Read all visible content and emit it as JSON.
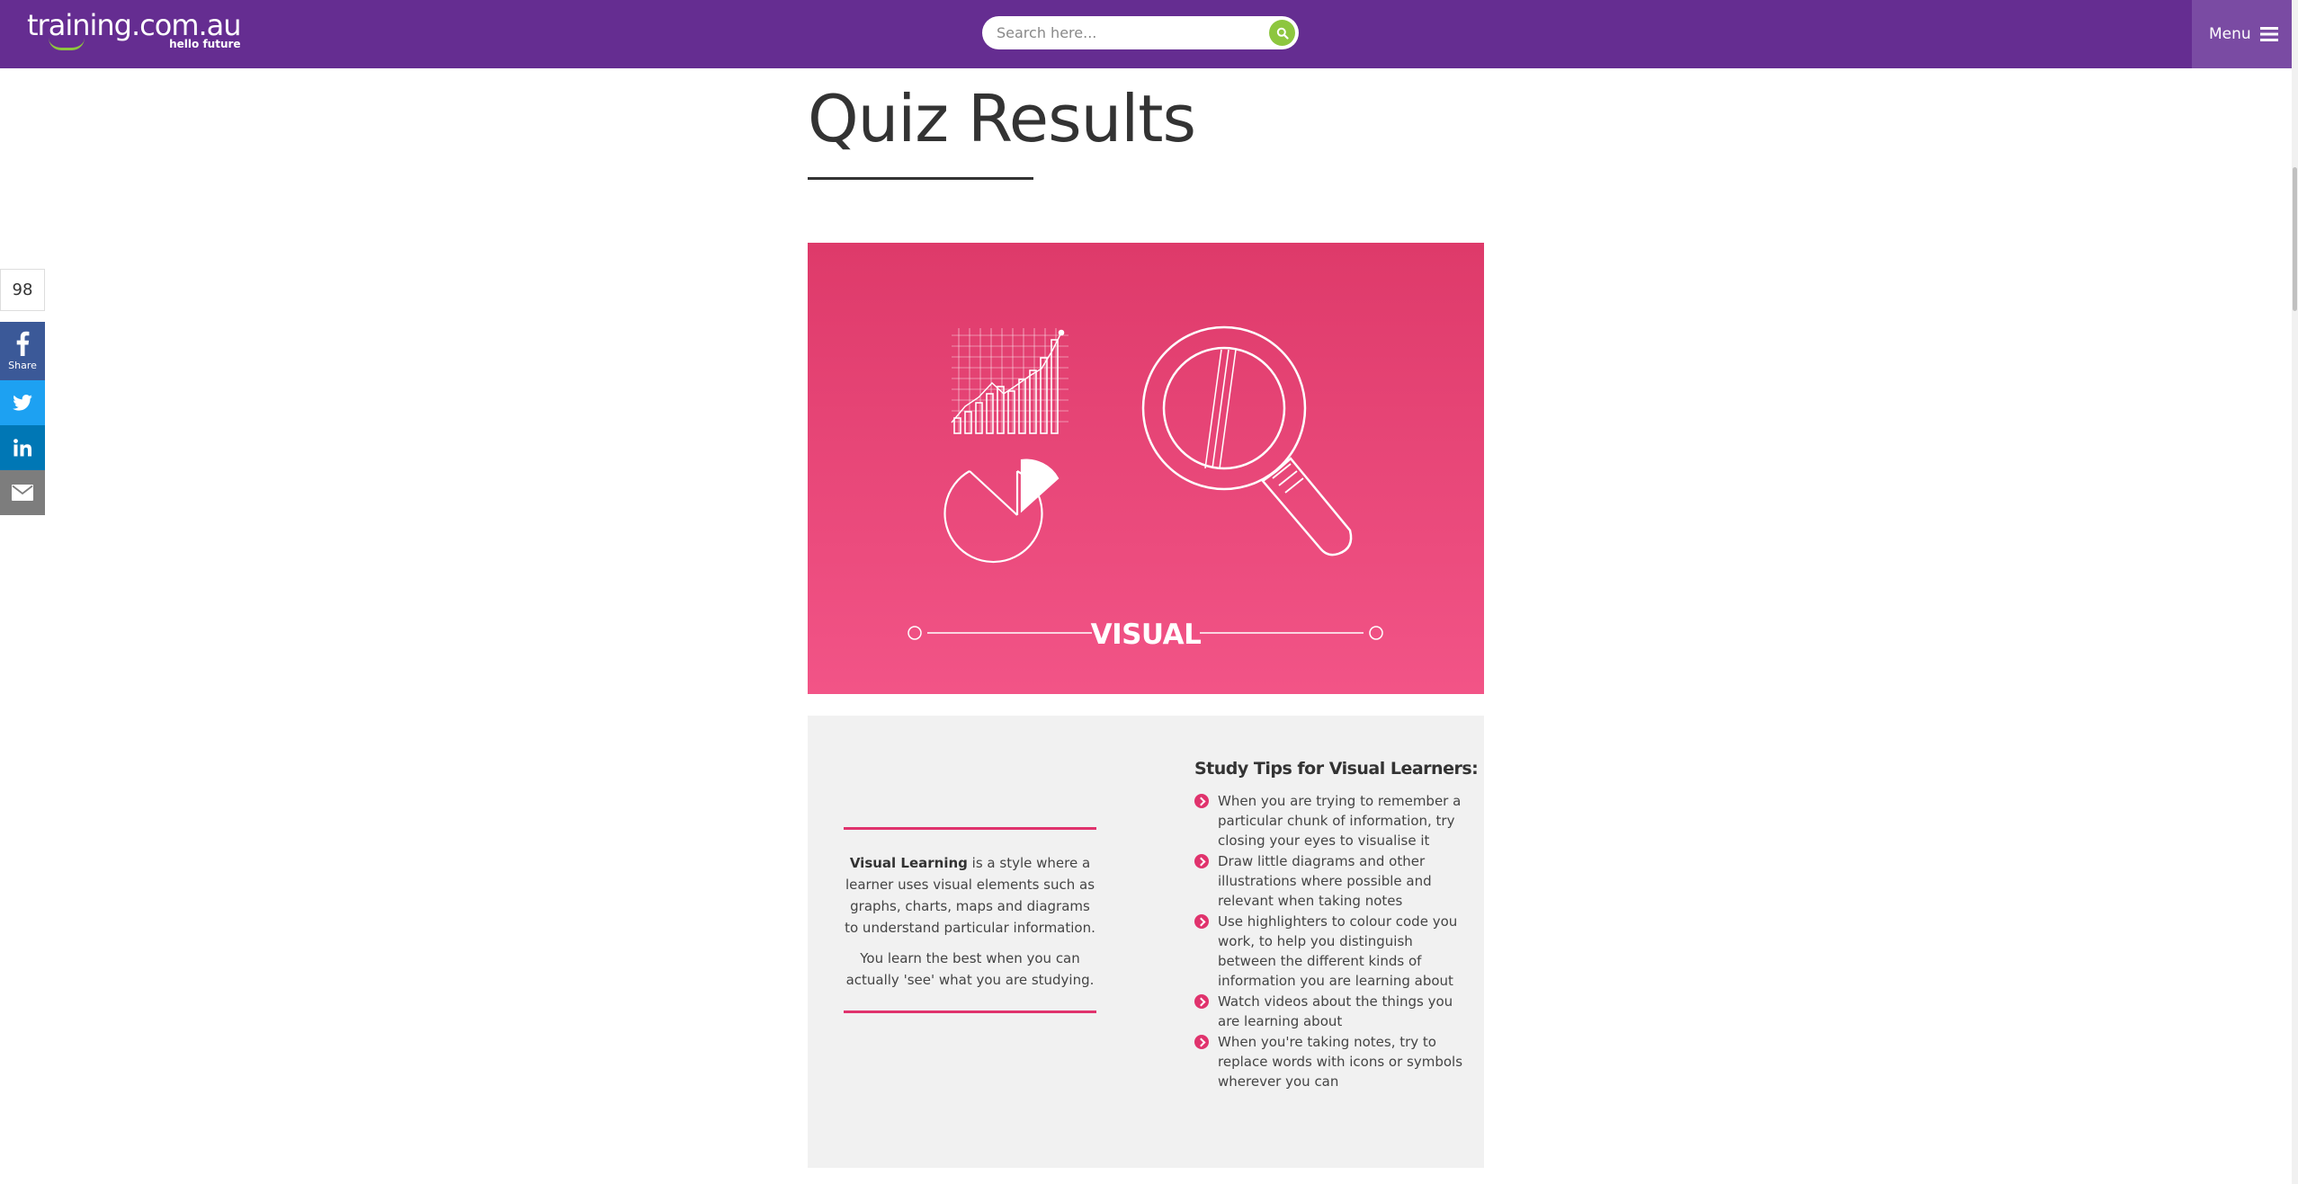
{
  "header": {
    "logo_main": "training.com.au",
    "logo_tagline": "hello future",
    "search_placeholder": "Search here...",
    "menu_label": "Menu"
  },
  "share": {
    "count": "98",
    "facebook_label": "Share",
    "icons": [
      "facebook-icon",
      "twitter-icon",
      "linkedin-icon",
      "email-icon"
    ]
  },
  "page": {
    "title": "Quiz Results"
  },
  "banner": {
    "label": "VISUAL",
    "icons": [
      "bar-chart-icon",
      "pie-chart-icon",
      "magnifying-glass-icon"
    ],
    "colors": {
      "top": "#de3a6a",
      "bottom": "#f25487"
    }
  },
  "description": {
    "term": "Visual Learning",
    "text1": " is a style where a learner uses visual elements such as graphs, charts, maps and diagrams to understand particular information.",
    "text2": "You learn the best when you can actually 'see' what you are studying."
  },
  "tips": {
    "title": "Study Tips for Visual Learners:",
    "items": [
      "When you are trying to remember a particular chunk of information, try closing your eyes to visualise it",
      "Draw little diagrams and other illustrations where possible and relevant when taking notes",
      "Use highlighters to colour code you work, to help you distinguish between the different kinds of information you are learning about",
      "Watch videos about the things you are learning about",
      "When you're taking notes, try to replace words with icons or symbols wherever you can"
    ]
  },
  "colors": {
    "header_bg": "#652d91",
    "accent_pink": "#e0336d",
    "accent_green": "#8dc63f"
  }
}
